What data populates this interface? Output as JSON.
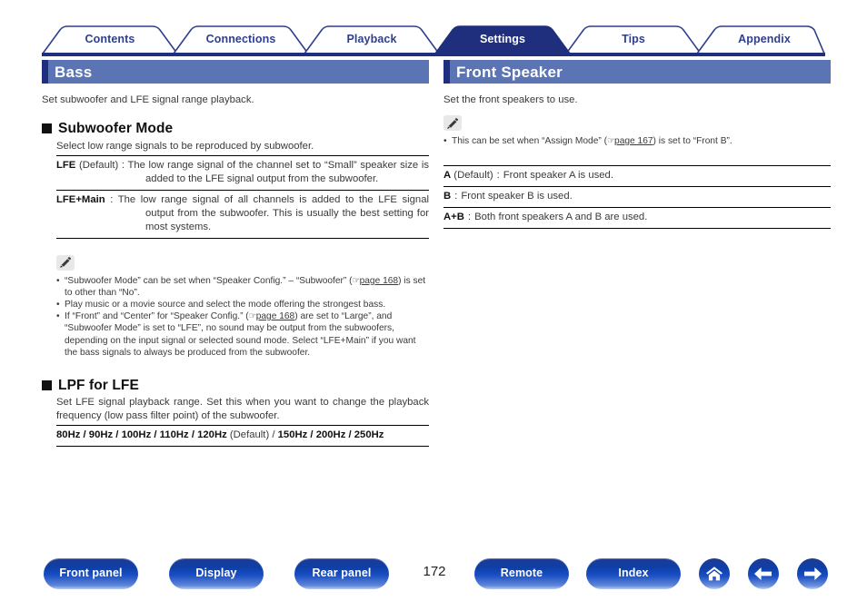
{
  "tabs": [
    {
      "label": "Contents",
      "active": false
    },
    {
      "label": "Connections",
      "active": false
    },
    {
      "label": "Playback",
      "active": false
    },
    {
      "label": "Settings",
      "active": true
    },
    {
      "label": "Tips",
      "active": false
    },
    {
      "label": "Appendix",
      "active": false
    }
  ],
  "left": {
    "heading": "Bass",
    "intro": "Set subwoofer and LFE signal range playback.",
    "section1": {
      "title": "Subwoofer Mode",
      "lead": "Select low range signals to be reproduced by subwoofer.",
      "rows": [
        {
          "term": "LFE",
          "qualifier": " (Default)",
          "desc": "The low range signal of the channel set to “Small” speaker size is added to the LFE signal output from the subwoofer."
        },
        {
          "term": "LFE+Main",
          "qualifier": "",
          "desc": "The low range signal of all channels is added to the LFE signal output from the subwoofer. This is usually the best setting for most systems."
        }
      ],
      "notes": [
        {
          "pre": "“Subwoofer Mode” can be set when “Speaker Config.” – “Subwoofer” (",
          "ref": "page 168",
          "post": ") is set to other than “No”."
        },
        {
          "pre": "Play music or a movie source and select the mode offering the strongest bass.",
          "ref": "",
          "post": ""
        },
        {
          "pre": "If “Front” and “Center” for “Speaker Config.” (",
          "ref": "page 168",
          "post": ") are set to “Large”, and “Subwoofer Mode” is set to “LFE”, no sound may be output from the subwoofers, depending on the input signal or selected sound mode. Select “LFE+Main” if you want the bass signals to always be produced from the subwoofer."
        }
      ]
    },
    "section2": {
      "title": "LPF for LFE",
      "lead": "Set LFE signal playback range. Set this when you want to change the playback frequency (low pass filter point) of the subwoofer.",
      "options_bold_1": "80Hz / 90Hz / 100Hz / 110Hz / 120Hz",
      "options_normal": " (Default) / ",
      "options_bold_2": "150Hz / 200Hz / 250Hz"
    }
  },
  "right": {
    "heading": "Front Speaker",
    "intro": "Set the front speakers to use.",
    "notes": [
      {
        "pre": "This can be set when “Assign Mode” (",
        "ref": "page 167",
        "post": ") is set to “Front B”."
      }
    ],
    "rows": [
      {
        "term": "A",
        "qualifier": " (Default)",
        "desc": "Front speaker A is used."
      },
      {
        "term": "B",
        "qualifier": "",
        "desc": "Front speaker B is used."
      },
      {
        "term": "A+B",
        "qualifier": "",
        "desc": "Both front speakers A and B are used."
      }
    ]
  },
  "bottom": {
    "buttons": [
      {
        "label": "Front panel"
      },
      {
        "label": "Display"
      },
      {
        "label": "Rear panel"
      },
      {
        "label": "Remote"
      },
      {
        "label": "Index"
      }
    ],
    "page_number": "172",
    "icons": [
      "home-icon",
      "arrow-left-icon",
      "arrow-right-icon"
    ]
  },
  "colors": {
    "tab_active_bg": "#1f2f7d",
    "tab_text": "#2d3f8f",
    "section_bar": "#5b74b4",
    "section_accent": "#1f2f7d"
  }
}
